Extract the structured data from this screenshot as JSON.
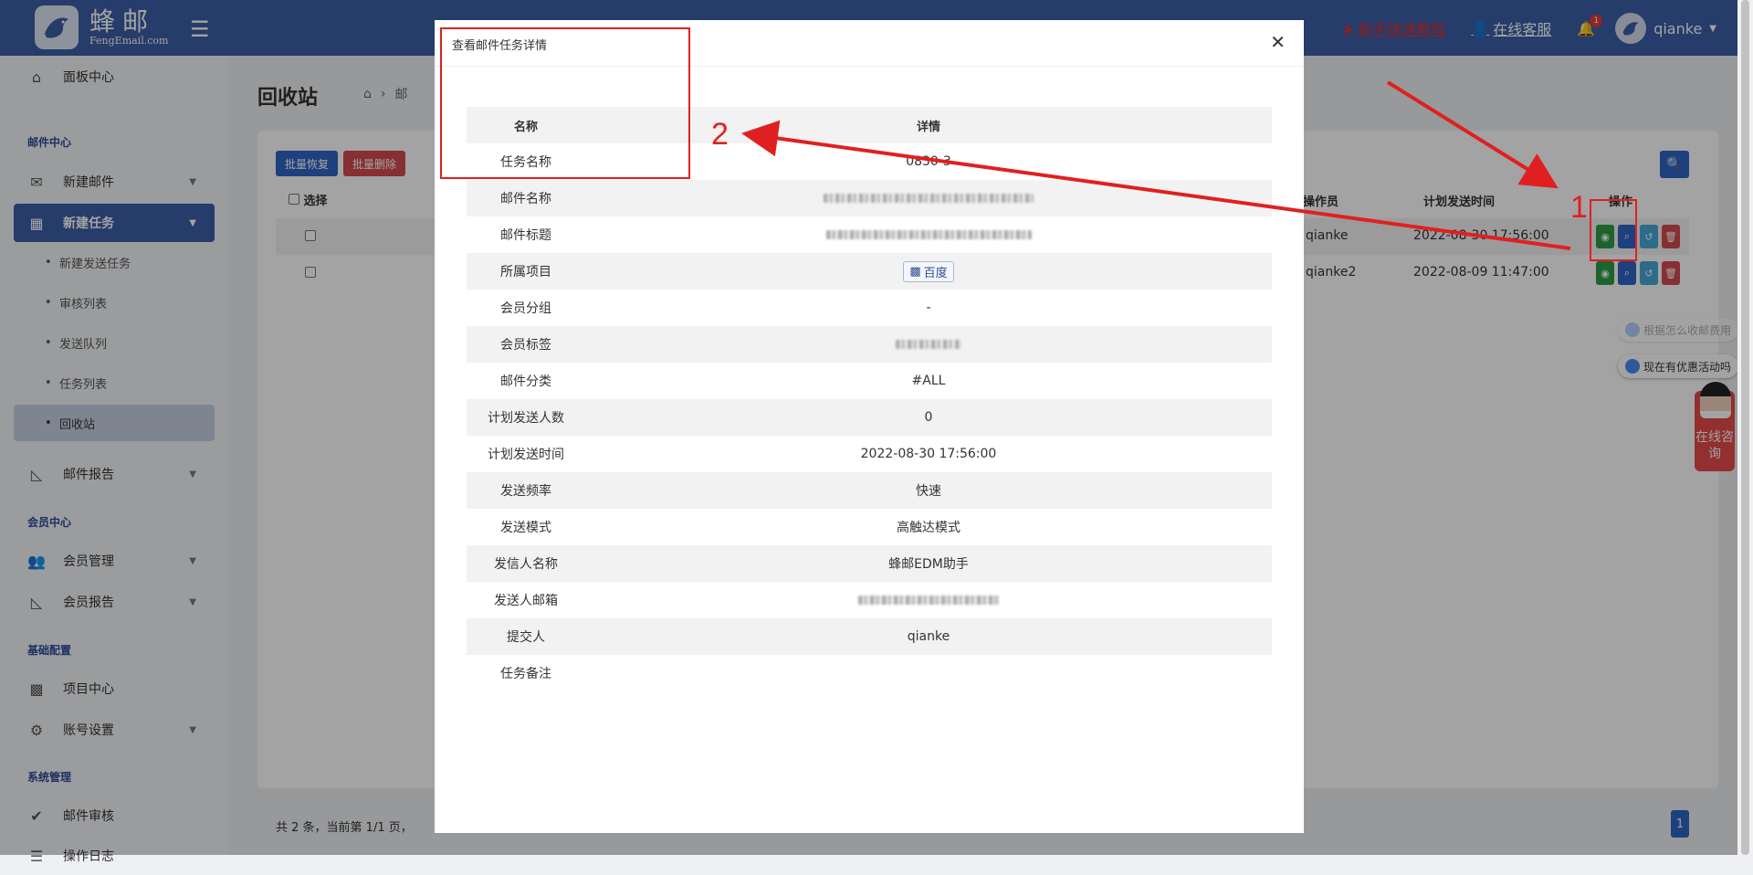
{
  "header": {
    "logo_cn": "蜂邮",
    "logo_en": "FengEmail.com",
    "tutorial": "新手快速教程",
    "service": "在线客服",
    "notifications": "1",
    "username": "qianke"
  },
  "sidebar": {
    "dashboard": "面板中心",
    "group_mail": "邮件中心",
    "new_mail": "新建邮件",
    "new_task": "新建任务",
    "subs": [
      "新建发送任务",
      "审核列表",
      "发送队列",
      "任务列表",
      "回收站"
    ],
    "mail_report": "邮件报告",
    "group_member": "会员中心",
    "member_manage": "会员管理",
    "member_report": "会员报告",
    "group_config": "基础配置",
    "project_center": "项目中心",
    "account_settings": "账号设置",
    "group_system": "系统管理",
    "mail_review": "邮件审核",
    "last_item": "操作日志"
  },
  "page": {
    "title": "回收站",
    "crumb_2": "邮",
    "batch_restore": "批量恢复",
    "batch_delete": "批量删除",
    "col_select": "选择",
    "col_operator": "操作员",
    "col_time": "计划发送时间",
    "col_action": "操作",
    "rows": [
      {
        "operator": "qianke",
        "time": "2022-08-30 17:56:00"
      },
      {
        "operator": "qianke2",
        "time": "2022-08-09 11:47:00"
      }
    ],
    "pager_text": "共 2 条，当前第 1/1 页，",
    "pager_num": "1"
  },
  "modal": {
    "title": "查看邮件任务详情",
    "col_name": "名称",
    "col_detail": "详情",
    "rows": [
      {
        "k": "任务名称",
        "v": "0830-3"
      },
      {
        "k": "邮件名称",
        "v": ""
      },
      {
        "k": "邮件标题",
        "v": ""
      },
      {
        "k": "所属项目",
        "v": "百度"
      },
      {
        "k": "会员分组",
        "v": "-"
      },
      {
        "k": "会员标签",
        "v": ""
      },
      {
        "k": "邮件分类",
        "v": "#ALL"
      },
      {
        "k": "计划发送人数",
        "v": "0"
      },
      {
        "k": "计划发送时间",
        "v": "2022-08-30 17:56:00"
      },
      {
        "k": "发送频率",
        "v": "快速"
      },
      {
        "k": "发送模式",
        "v": "高触达模式"
      },
      {
        "k": "发信人名称",
        "v": "蜂邮EDM助手"
      },
      {
        "k": "发送人邮箱",
        "v": ""
      },
      {
        "k": "提交人",
        "v": "qianke"
      },
      {
        "k": "任务备注",
        "v": ""
      }
    ]
  },
  "annotations": {
    "one": "1",
    "two": "2",
    "color": "#e02020"
  },
  "widgets": {
    "pill_1": "根据怎么收邮费用",
    "pill_2": "现在有优惠活动吗",
    "consult": "在线咨询"
  },
  "colors": {
    "topbar": "#3c5ea6",
    "primary": "#2f65c5",
    "danger": "#d34a51",
    "success": "#2e9d45"
  }
}
